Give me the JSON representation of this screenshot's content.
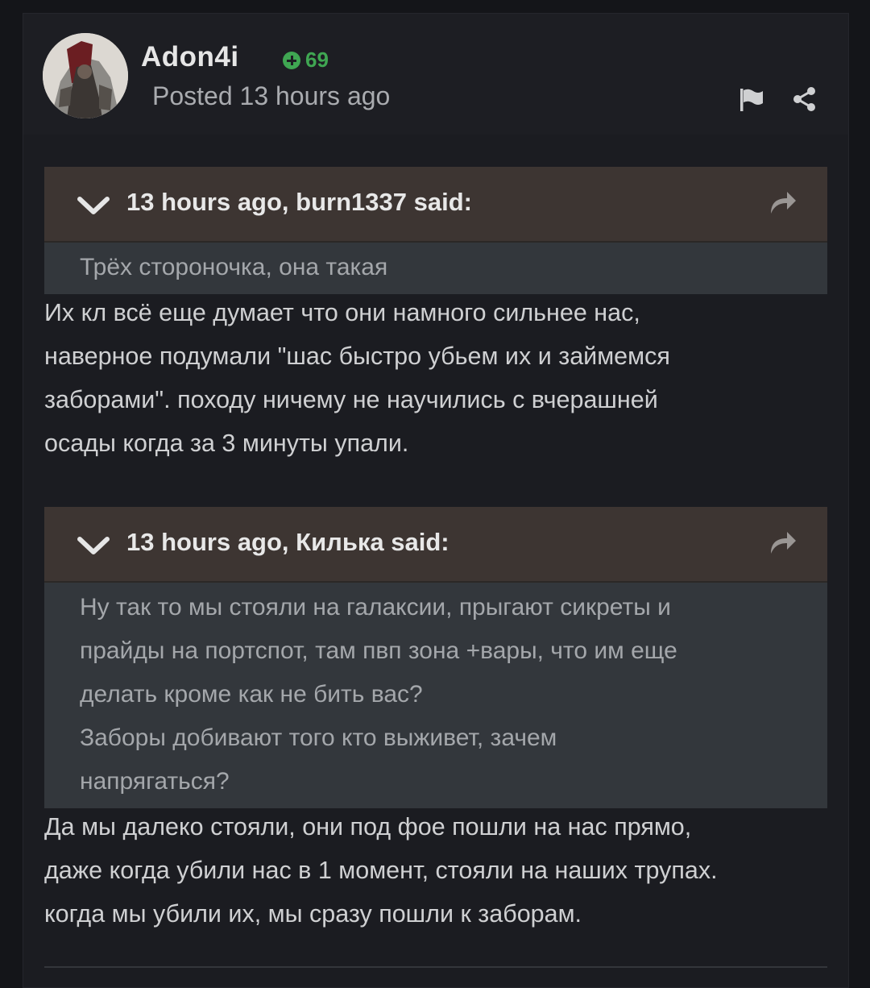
{
  "post": {
    "author": "Adon4i",
    "reputation": "69",
    "posted": "Posted 13 hours ago"
  },
  "quotes": [
    {
      "citation": "13 hours ago, burn1337 said:",
      "lines": [
        "Трёх стороночка, она такая"
      ]
    },
    {
      "citation": "13 hours ago, Килька said:",
      "lines": [
        "Ну так то мы стояли на галаксии, прыгают сикреты и",
        "прайды на портспот, там пвп зона +вары, что им еще",
        "делать кроме как не бить вас?",
        "Заборы добивают того кто выживет, зачем",
        "напрягаться?"
      ]
    }
  ],
  "replies": [
    {
      "lines": [
        "Их кл всё еще думает что они намного сильнее нас,",
        "наверное подумали \"шас быстро убьем их и займемся",
        "заборами\".  походу ничему не научились с вчерашней",
        "осады когда за 3 минуты упали."
      ]
    },
    {
      "lines": [
        "Да мы далеко стояли, они под фое пошли на нас прямо,",
        "даже когда убили нас в 1 момент, стояли на наших трупах.",
        "когда мы убили их, мы сразу пошли к заборам."
      ]
    }
  ],
  "icons": {
    "report": "flag-icon",
    "share": "share-icon",
    "collapse": "chevron-down-icon",
    "go_to_quote": "share-arrow-icon"
  },
  "colors": {
    "page_bg": "#141519",
    "quote_header": "#3d3532",
    "quote_body": "#33373c",
    "reputation": "#3fa652"
  }
}
